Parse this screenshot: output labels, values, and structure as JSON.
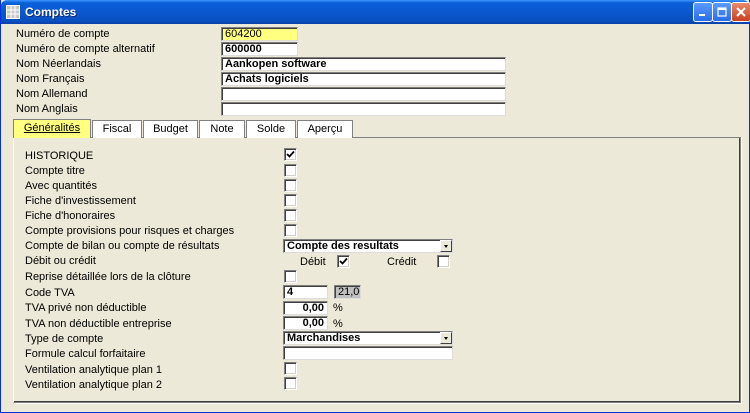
{
  "window": {
    "title": "Comptes"
  },
  "header": {
    "numero_label": "Numéro de compte",
    "numero_value": "604200",
    "alt_label": "Numéro de compte alternatif",
    "alt_value": "600000",
    "nl_label": "Nom Néerlandais",
    "nl_value": "Aankopen software",
    "fr_label": "Nom Français",
    "fr_value": "Achats logiciels",
    "de_label": "Nom Allemand",
    "de_value": "",
    "en_label": "Nom Anglais",
    "en_value": ""
  },
  "tabs": [
    {
      "label": "Généralités"
    },
    {
      "label": "Fiscal"
    },
    {
      "label": "Budget"
    },
    {
      "label": "Note"
    },
    {
      "label": "Solde"
    },
    {
      "label": "Aperçu"
    }
  ],
  "form": {
    "historique": "HISTORIQUE",
    "compte_titre": "Compte titre",
    "avec_quantites": "Avec quantités",
    "fiche_invest": "Fiche d'investissement",
    "fiche_honoraires": "Fiche d'honoraires",
    "provisions": "Compte provisions pour risques et charges",
    "bilan_label": "Compte de bilan ou compte de résultats",
    "bilan_value": "Compte des resultats",
    "debit_credit_label": "Débit ou crédit",
    "debit_label": "Débit",
    "credit_label": "Crédit",
    "reprise": "Reprise détaillée lors de la clôture",
    "code_tva_label": "Code TVA",
    "code_tva_value": "4",
    "code_tva_rate": "21,00",
    "tva_prive_label": "TVA privé non déductible",
    "tva_prive_value": "0,00",
    "tva_entreprise_label": "TVA non déductible entreprise",
    "tva_entreprise_value": "0,00",
    "percent": "%",
    "type_label": "Type de compte",
    "type_value": "Marchandises",
    "formule_label": "Formule calcul forfaitaire",
    "formule_value": "",
    "vent1": "Ventilation analytique plan 1",
    "vent2": "Ventilation analytique plan 2"
  }
}
